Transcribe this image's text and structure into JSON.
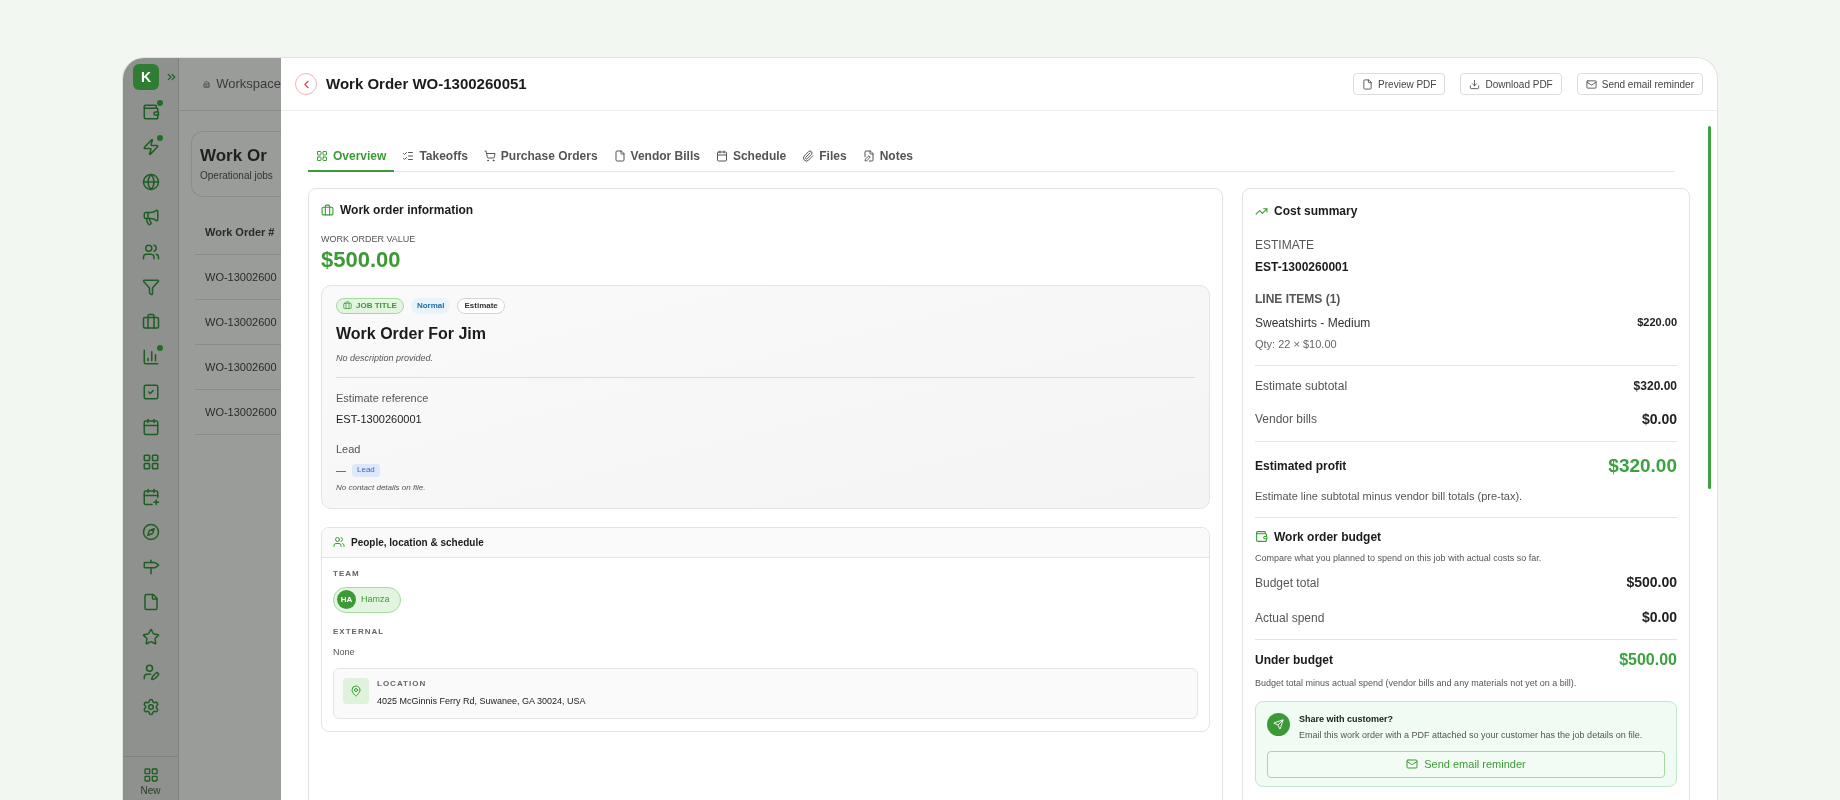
{
  "sidebar": {
    "logo": "K",
    "items": [
      {
        "badge": true
      },
      {
        "badge": true
      },
      {
        "badge": false
      },
      {
        "badge": false
      },
      {
        "badge": false
      },
      {
        "badge": false
      },
      {
        "badge": false
      },
      {
        "badge": true
      },
      {
        "badge": false
      },
      {
        "badge": false
      },
      {
        "badge": false
      },
      {
        "badge": false
      },
      {
        "badge": false
      },
      {
        "badge": false
      },
      {
        "badge": false
      },
      {
        "badge": false
      },
      {
        "badge": false
      },
      {
        "badge": false
      }
    ],
    "new_label": "New"
  },
  "background": {
    "breadcrumb": "Workspace",
    "page_title": "Work Or",
    "page_subtitle": "Operational jobs",
    "column": "Work Order #",
    "rows": [
      "WO-13002600",
      "WO-13002600",
      "WO-13002600",
      "WO-13002600"
    ]
  },
  "drawer": {
    "title": "Work Order WO-1300260051",
    "actions": [
      {
        "label": "Preview PDF"
      },
      {
        "label": "Download PDF"
      },
      {
        "label": "Send email reminder"
      }
    ],
    "tabs": [
      {
        "label": "Overview",
        "selected": true
      },
      {
        "label": "Takeoffs",
        "selected": false
      },
      {
        "label": "Purchase Orders",
        "selected": false
      },
      {
        "label": "Vendor Bills",
        "selected": false
      },
      {
        "label": "Schedule",
        "selected": false
      },
      {
        "label": "Files",
        "selected": false
      },
      {
        "label": "Notes",
        "selected": false
      }
    ]
  },
  "work_order_information": {
    "title": "Work order information",
    "value_label": "WORK ORDER VALUE",
    "value": "$500.00",
    "job": {
      "tags": [
        {
          "kind": "job_title",
          "text": "JOB TITLE"
        },
        {
          "kind": "priority",
          "text": "Normal"
        },
        {
          "kind": "source",
          "text": "Estimate"
        }
      ],
      "title": "Work Order For Jim",
      "description": "No description provided.",
      "estimate_reference": {
        "label": "Estimate reference",
        "value": "EST-1300260001"
      },
      "lead": {
        "label": "Lead",
        "dash": "—",
        "tag": "Lead",
        "note": "No contact details on file."
      }
    }
  },
  "people": {
    "title": "People, location & schedule",
    "team_label": "TEAM",
    "team": [
      {
        "initials": "HA",
        "name": "Hamza"
      }
    ],
    "external_label": "EXTERNAL",
    "external_value": "None",
    "location": {
      "label": "LOCATION",
      "address": "4025 McGinnis Ferry Rd, Suwanee, GA 30024, USA"
    }
  },
  "cost_summary": {
    "title": "Cost summary",
    "estimate_label": "ESTIMATE",
    "estimate_value": "EST-1300260001",
    "line_items_label": "LINE ITEMS (1)",
    "line_items": [
      {
        "name": "Sweatshirts - Medium",
        "qty": "Qty: 22 × $10.00",
        "amount": "$220.00"
      }
    ],
    "rows": [
      {
        "label": "Estimate subtotal",
        "value": "$320.00"
      },
      {
        "label": "Vendor bills",
        "value": "$0.00"
      }
    ],
    "profit": {
      "label": "Estimated profit",
      "value": "$320.00",
      "note": "Estimate line subtotal minus vendor bill totals (pre-tax)."
    },
    "budget": {
      "title": "Work order budget",
      "description": "Compare what you planned to spend on this job with actual costs so far.",
      "rows": [
        {
          "label": "Budget total",
          "value": "$500.00"
        },
        {
          "label": "Actual spend",
          "value": "$0.00"
        }
      ],
      "result": {
        "label": "Under budget",
        "value": "$500.00",
        "note": "Budget total minus actual spend (vendor bills and any materials not yet on a bill)."
      }
    },
    "share": {
      "title": "Share with customer?",
      "text": "Email this work order with a PDF attached so your customer has the job details on file.",
      "button": "Send email reminder"
    }
  }
}
